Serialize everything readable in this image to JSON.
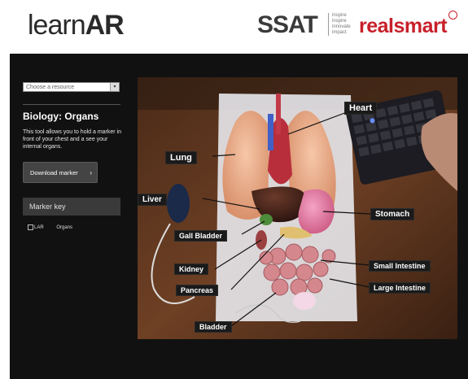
{
  "header": {
    "logo_light": "learn",
    "logo_bold": "AR",
    "ssat": "SSAT",
    "ssat_tagline": [
      "inspire",
      "inspire",
      "innovate",
      "impact"
    ],
    "realsmart": "realsmart",
    "brand_red": "#c8202a"
  },
  "sidebar": {
    "resource_select": {
      "value": "Choose a resource"
    },
    "title": "Biology: Organs",
    "description": "This tool allows you to hold a marker in front of your chest and a see your internal organs.",
    "download_label": "Download marker",
    "marker_key_label": "Marker key",
    "marker_items": [
      "LAR",
      "Organs"
    ]
  },
  "scene": {
    "labels": {
      "heart": "Heart",
      "lung": "Lung",
      "liver": "Liver",
      "stomach": "Stomach",
      "gall_bladder": "Gall Bladder",
      "kidney": "Kidney",
      "pancreas": "Pancreas",
      "small_intestine": "Small Intestine",
      "large_intestine": "Large Intestine",
      "bladder": "Bladder"
    }
  }
}
